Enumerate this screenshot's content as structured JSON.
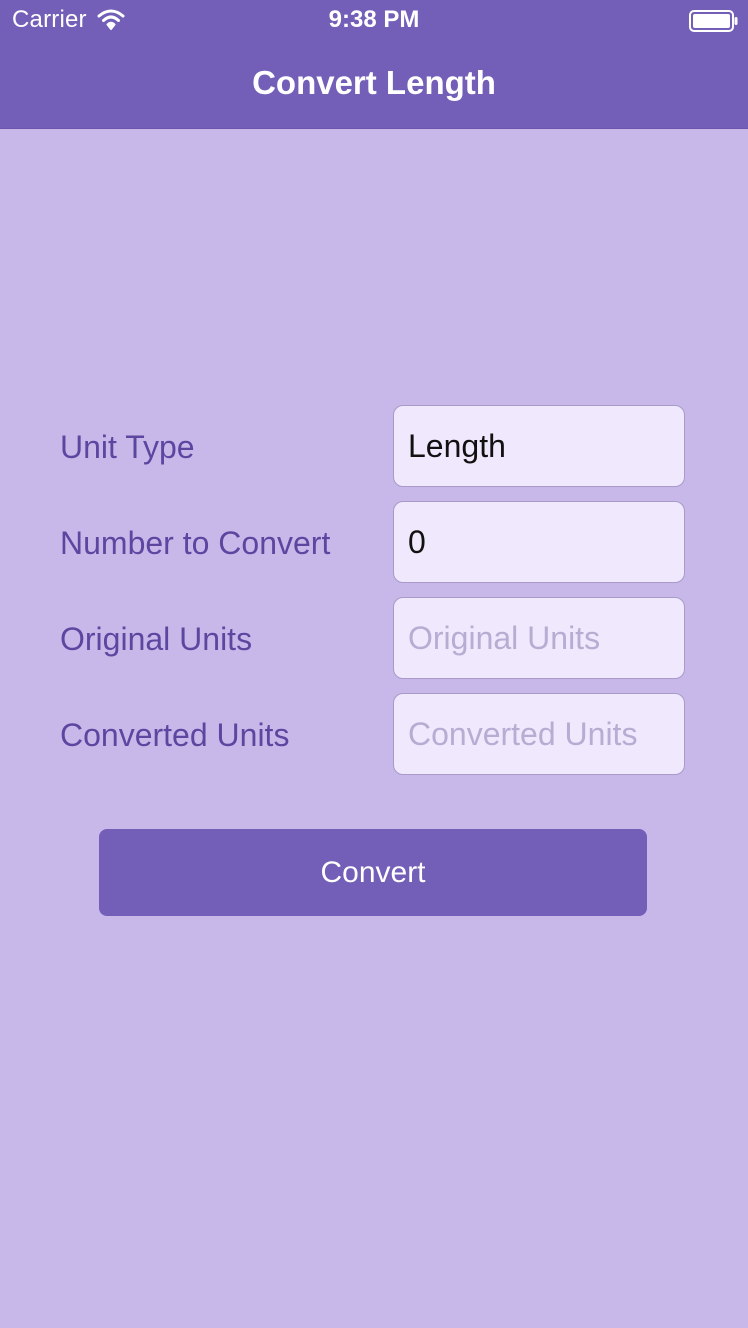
{
  "status_bar": {
    "carrier": "Carrier",
    "time": "9:38 PM",
    "wifi_icon": "wifi-icon",
    "battery_icon": "battery-icon"
  },
  "nav": {
    "title": "Convert Length"
  },
  "form": {
    "unit_type": {
      "label": "Unit Type",
      "value": "Length",
      "placeholder": ""
    },
    "number_to_convert": {
      "label": "Number to Convert",
      "value": "0",
      "placeholder": ""
    },
    "original_units": {
      "label": "Original Units",
      "value": "",
      "placeholder": "Original Units"
    },
    "converted_units": {
      "label": "Converted Units",
      "value": "",
      "placeholder": "Converted Units"
    }
  },
  "convert_button": {
    "label": "Convert"
  },
  "colors": {
    "header": "#735fb8",
    "background": "#c8b8ea",
    "label_text": "#5b47a0",
    "field_background": "#f0e8fd",
    "button": "#735fb8"
  }
}
